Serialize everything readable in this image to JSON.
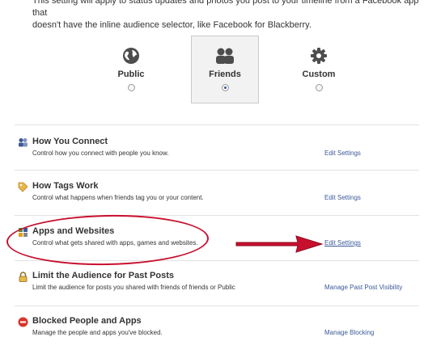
{
  "intro": {
    "line1": "This setting will apply to status updates and photos you post to your timeline from a Facebook app that",
    "line2": "doesn't have the inline audience selector, like Facebook for Blackberry."
  },
  "audience": [
    {
      "label": "Public",
      "icon": "globe-icon",
      "selected": false
    },
    {
      "label": "Friends",
      "icon": "friends-icon",
      "selected": true
    },
    {
      "label": "Custom",
      "icon": "gear-icon",
      "selected": false
    }
  ],
  "settings": [
    {
      "title": "How You Connect",
      "description": "Control how you connect with people you know.",
      "link": "Edit Settings",
      "icon": "people-icon"
    },
    {
      "title": "How Tags Work",
      "description": "Control what happens when friends tag you or your content.",
      "link": "Edit Settings",
      "icon": "tag-icon"
    },
    {
      "title": "Apps and Websites",
      "description": "Control what gets shared with apps, games and websites.",
      "link": "Edit Settings",
      "icon": "apps-icon"
    },
    {
      "title": "Limit the Audience for Past Posts",
      "description": "Limit the audience for posts you shared with friends of friends or Public",
      "link": "Manage Past Post Visibility",
      "icon": "lock-icon"
    },
    {
      "title": "Blocked People and Apps",
      "description": "Manage the people and apps you've blocked.",
      "link": "Manage Blocking",
      "icon": "blocked-icon"
    }
  ],
  "colors": {
    "link": "#3b5998",
    "annotation": "#c8102e"
  }
}
